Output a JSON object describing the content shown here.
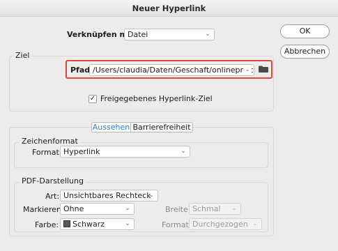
{
  "window": {
    "title": "Neuer Hyperlink"
  },
  "buttons": {
    "ok": "OK",
    "cancel": "Abbrechen"
  },
  "link": {
    "label": "Verknüpfen mit:",
    "value": "Datei"
  },
  "ziel": {
    "group_label": "Ziel",
    "path_label": "Pfad:",
    "path_value": "/Users/claudia/Daten/Geschaft/onlineprinters/",
    "shared_checkbox_label": "Freigegebenes Hyperlink-Ziel",
    "shared_checked": true
  },
  "tabs": {
    "active": "Aussehen",
    "other": "Barrierefreiheit"
  },
  "zeichenformat": {
    "group_label": "Zeichenformat",
    "format_label": "Format:",
    "format_value": "Hyperlink"
  },
  "pdf": {
    "group_label": "PDF-Darstellung",
    "art_label": "Art:",
    "art_value": "Unsichtbares Rechteck",
    "markieren_label": "Markieren:",
    "markieren_value": "Ohne",
    "farbe_label": "Farbe:",
    "farbe_value": "Schwarz",
    "breite_label": "Breite:",
    "breite_value": "Schmal",
    "format_label": "Format:",
    "format_value": "Durchgezogen"
  },
  "colors": {
    "highlight": "#e0443a",
    "accent_tab": "#2a7ed6",
    "swatch": "#5a5a5a"
  }
}
